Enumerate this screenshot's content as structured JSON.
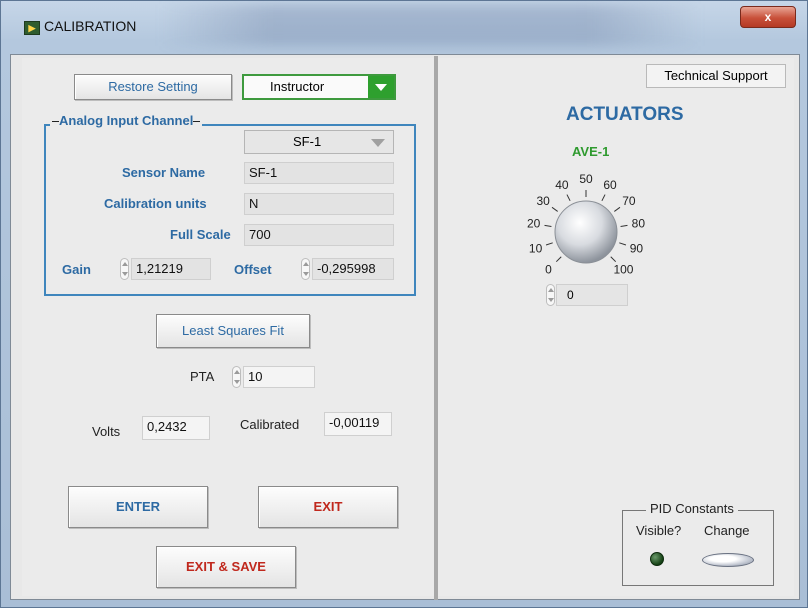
{
  "window": {
    "title": "CALIBRATION",
    "icon": "labview-vi-icon",
    "close_label": "x"
  },
  "toolbar": {
    "restore_label": "Restore Setting",
    "user_select_value": "Instructor"
  },
  "analog_channel": {
    "group_title": "Analog Input Channel",
    "channel_value": "SF-1",
    "sensor_name_label": "Sensor Name",
    "sensor_name_value": "SF-1",
    "calibration_units_label": "Calibration units",
    "calibration_units_value": "N",
    "full_scale_label": "Full Scale",
    "full_scale_value": "700",
    "gain_label": "Gain",
    "gain_value": "1,21219",
    "offset_label": "Offset",
    "offset_value": "-0,295998"
  },
  "calibration": {
    "least_squares_label": "Least Squares Fit",
    "pta_label": "PTA",
    "pta_value": "10",
    "volts_label": "Volts",
    "volts_value": "0,2432",
    "calibrated_label": "Calibrated",
    "calibrated_value": "-0,00119"
  },
  "actions": {
    "enter_label": "ENTER",
    "exit_label": "EXIT",
    "exit_save_label": "EXIT & SAVE"
  },
  "right_panel": {
    "tech_support_label": "Technical Support",
    "actuators_title": "ACTUATORS",
    "knob_label": "AVE-1",
    "knob_value": "0",
    "dial_ticks": [
      "0",
      "10",
      "20",
      "30",
      "40",
      "50",
      "60",
      "70",
      "80",
      "90",
      "100"
    ],
    "dial_min": 0,
    "dial_max": 100,
    "dial_current": 0
  },
  "pid": {
    "group_title": "PID Constants",
    "visible_label": "Visible?",
    "change_label": "Change",
    "visible_state": false
  },
  "colors": {
    "accent_blue": "#2d6aa3",
    "accent_green": "#2e9a2e",
    "accent_red": "#c0281d",
    "frame_blue": "#3f86bd"
  }
}
